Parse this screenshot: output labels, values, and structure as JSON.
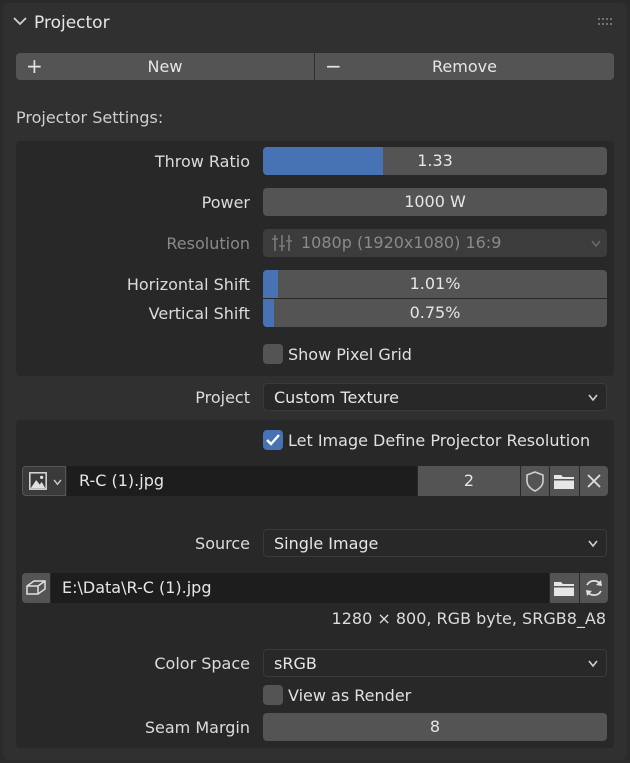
{
  "panel": {
    "title": "Projector"
  },
  "actions": {
    "new_label": "New",
    "remove_label": "Remove"
  },
  "settings": {
    "heading": "Projector Settings:",
    "throw_ratio": {
      "label": "Throw Ratio",
      "value": "1.33",
      "fill_fraction": 0.35
    },
    "power": {
      "label": "Power",
      "value": "1000 W"
    },
    "resolution": {
      "label": "Resolution",
      "value": "1080p (1920x1080) 16:9"
    },
    "horizontal_shift": {
      "label": "Horizontal Shift",
      "value": "1.01%",
      "fill_fraction": 0.045
    },
    "vertical_shift": {
      "label": "Vertical Shift",
      "value": "0.75%",
      "fill_fraction": 0.032
    },
    "show_pixel_grid": {
      "label": "Show Pixel Grid",
      "checked": false
    }
  },
  "project": {
    "label": "Project",
    "value": "Custom Texture"
  },
  "texture": {
    "let_image_define": {
      "label": "Let Image Define Projector Resolution",
      "checked": true
    },
    "image_name": "R-C (1).jpg",
    "users": "2",
    "source": {
      "label": "Source",
      "value": "Single Image"
    },
    "filepath": "E:\\Data\\R-C (1).jpg",
    "info": "1280 × 800,  RGB byte, SRGB8_A8",
    "color_space": {
      "label": "Color Space",
      "value": "sRGB"
    },
    "view_as_render": {
      "label": "View as Render",
      "checked": false
    },
    "seam_margin": {
      "label": "Seam Margin",
      "value": "8"
    }
  },
  "colors": {
    "accent": "#4772b3",
    "panel_bg": "#303030",
    "field_bg": "#545454",
    "box_bg": "#282828"
  }
}
